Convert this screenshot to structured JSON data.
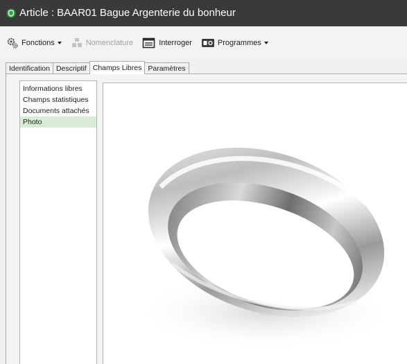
{
  "window": {
    "title": "Article : BAAR01 Bague Argenterie du bonheur",
    "title_icon": "green-shield-icon",
    "accent_color": "#2e9e3e"
  },
  "toolbar": {
    "items": [
      {
        "label": "Fonctions",
        "icon": "gears-icon",
        "dropdown": true,
        "enabled": true
      },
      {
        "label": "Nomenclature",
        "icon": "boxes-icon",
        "dropdown": false,
        "enabled": false
      },
      {
        "label": "Interroger",
        "icon": "query-window-icon",
        "dropdown": false,
        "enabled": true
      },
      {
        "label": "Programmes",
        "icon": "programs-icon",
        "dropdown": true,
        "enabled": true
      }
    ]
  },
  "tabs": [
    {
      "label": "Identification",
      "active": false
    },
    {
      "label": "Descriptif",
      "active": false
    },
    {
      "label": "Champs Libres",
      "active": true
    },
    {
      "label": "Paramètres",
      "active": false
    }
  ],
  "side_list": {
    "items": [
      {
        "label": "Informations libres",
        "selected": false
      },
      {
        "label": "Champs statistiques",
        "selected": false
      },
      {
        "label": "Documents attachés",
        "selected": false
      },
      {
        "label": "Photo",
        "selected": true
      }
    ],
    "selected_color": "#d6ecd5"
  },
  "photo": {
    "subject": "silver-wedding-band-image"
  }
}
